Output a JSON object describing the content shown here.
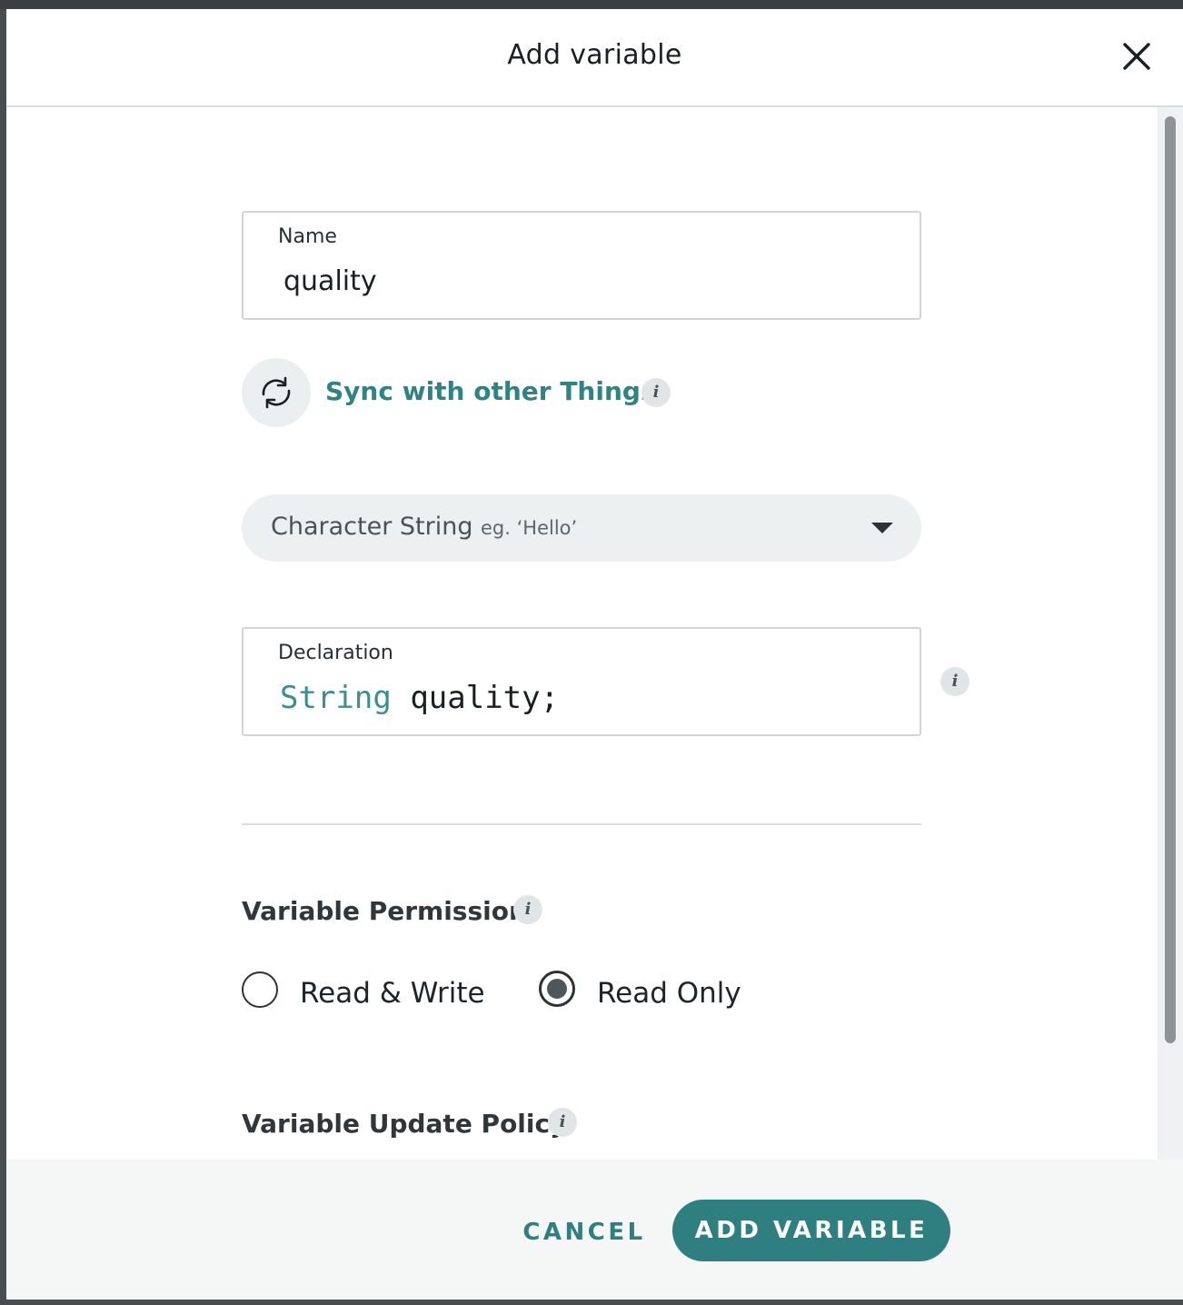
{
  "dialog": {
    "title": "Add variable"
  },
  "name_field": {
    "label": "Name",
    "value": "quality"
  },
  "sync": {
    "label": "Sync with other Things"
  },
  "type_select": {
    "selected": "Character String",
    "example": "eg. ‘Hello’"
  },
  "declaration": {
    "label": "Declaration",
    "type_keyword": "String",
    "variable": "quality",
    "terminator": ";"
  },
  "permission": {
    "title": "Variable Permission",
    "options": [
      {
        "label": "Read & Write",
        "selected": false
      },
      {
        "label": "Read Only",
        "selected": true
      }
    ]
  },
  "update_policy": {
    "title": "Variable Update Policy"
  },
  "footer": {
    "cancel_label": "CANCEL",
    "submit_label": "ADD VARIABLE"
  },
  "icons": {
    "info": "i",
    "close": "close-icon",
    "sync": "sync-icon",
    "dropdown": "chevron-down-icon"
  },
  "colors": {
    "accent": "#2f7f81",
    "sync_text": "#2f8385",
    "type_keyword": "#3d8f8f"
  }
}
